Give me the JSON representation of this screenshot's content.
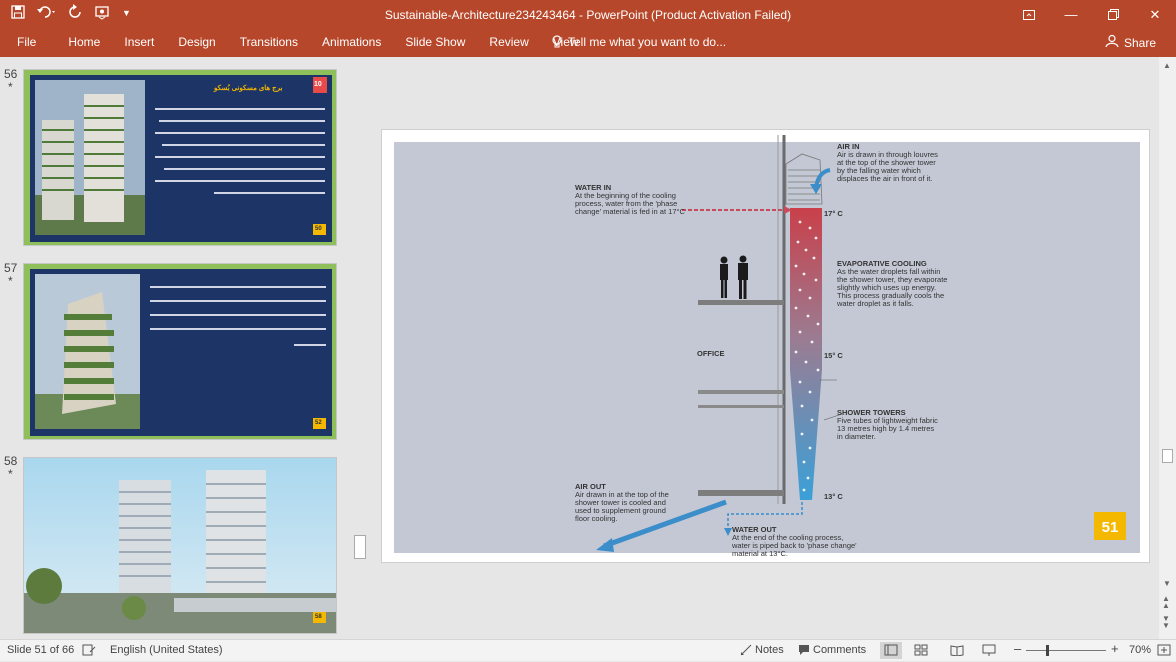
{
  "window": {
    "title": "Sustainable-Architecture234243464 - PowerPoint (Product Activation Failed)"
  },
  "ribbon": {
    "tabs": [
      "File",
      "Home",
      "Insert",
      "Design",
      "Transitions",
      "Animations",
      "Slide Show",
      "Review",
      "View"
    ],
    "tell_me": "Tell me what you want to do...",
    "share": "Share"
  },
  "thumbnails": [
    {
      "number": "56",
      "star": "*",
      "heading": "برج های مسکونی بُسکو",
      "badge_top": "10",
      "badge": "50"
    },
    {
      "number": "57",
      "star": "*",
      "badge": "52"
    },
    {
      "number": "58",
      "star": "*",
      "badge": "58"
    }
  ],
  "slide": {
    "page_number": "51",
    "labels": {
      "air_in_title": "AIR IN",
      "air_in_body": [
        "Air is drawn in through louvres",
        "at the top of the shower tower",
        "by the falling water which",
        "displaces the air in front of it."
      ],
      "water_in_title": "WATER IN",
      "water_in_body": [
        "At the beginning of the cooling",
        "process, water from the 'phase",
        "change' material is fed in at 17°C"
      ],
      "temp_top": "17° C",
      "evap_title": "EVAPORATIVE COOLING",
      "evap_body": [
        "As the water droplets fall within",
        "the shower tower, they evaporate",
        "slightly which uses up energy.",
        "This process gradually cools the",
        "water droplet as it falls."
      ],
      "office": "OFFICE",
      "temp_mid": "15° C",
      "shower_title": "SHOWER TOWERS",
      "shower_body": [
        "Five tubes of lightweight fabric",
        "13 metres high by 1.4 metres",
        "in diameter."
      ],
      "air_out_title": "AIR OUT",
      "air_out_body": [
        "Air drawn in at the top of the",
        "shower tower is cooled and",
        "used to supplement ground",
        "floor cooling."
      ],
      "temp_bottom": "13° C",
      "water_out_title": "WATER OUT",
      "water_out_body": [
        "At the end of the cooling process,",
        "water is piped back  to 'phase change'",
        "material at 13°C."
      ]
    }
  },
  "status": {
    "slide_of": "Slide 51 of 66",
    "language": "English (United States)",
    "notes": "Notes",
    "comments": "Comments",
    "zoom": "70%"
  },
  "colors": {
    "accent": "#b7472a",
    "slide_bg": "#c3c8d4",
    "badge": "#f5b800"
  }
}
